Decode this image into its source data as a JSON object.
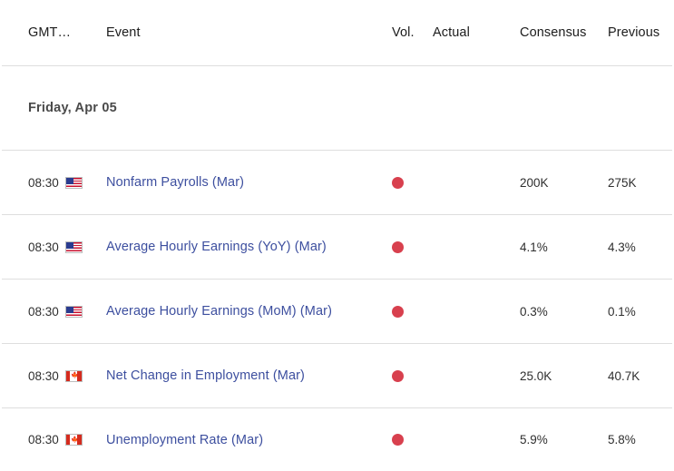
{
  "table": {
    "columns": [
      {
        "key": "gmt",
        "label": "GMT…"
      },
      {
        "key": "event",
        "label": "Event"
      },
      {
        "key": "vol",
        "label": "Vol."
      },
      {
        "key": "actual",
        "label": "Actual"
      },
      {
        "key": "consensus",
        "label": "Consensus"
      },
      {
        "key": "previous",
        "label": "Previous"
      }
    ],
    "date_group": {
      "label": "Friday, Apr 05"
    },
    "rows": [
      {
        "time": "08:30",
        "flag": "us-flag-icon",
        "flag_emoji": "🇺🇸",
        "event": "Nonfarm Payrolls (Mar)",
        "volatility": "high",
        "volatility_color": "#d8404e",
        "actual": "",
        "consensus": "200K",
        "previous": "275K"
      },
      {
        "time": "08:30",
        "flag": "us-flag-icon",
        "flag_emoji": "🇺🇸",
        "event": "Average Hourly Earnings (YoY) (Mar)",
        "volatility": "high",
        "volatility_color": "#d8404e",
        "actual": "",
        "consensus": "4.1%",
        "previous": "4.3%"
      },
      {
        "time": "08:30",
        "flag": "us-flag-icon",
        "flag_emoji": "🇺🇸",
        "event": "Average Hourly Earnings (MoM) (Mar)",
        "volatility": "high",
        "volatility_color": "#d8404e",
        "actual": "",
        "consensus": "0.3%",
        "previous": "0.1%"
      },
      {
        "time": "08:30",
        "flag": "ca-flag-icon",
        "flag_emoji": "🇨🇦",
        "event": "Net Change in Employment (Mar)",
        "volatility": "high",
        "volatility_color": "#d8404e",
        "actual": "",
        "consensus": "25.0K",
        "previous": "40.7K"
      },
      {
        "time": "08:30",
        "flag": "ca-flag-icon",
        "flag_emoji": "🇨🇦",
        "event": "Unemployment Rate (Mar)",
        "volatility": "high",
        "volatility_color": "#d8404e",
        "actual": "",
        "consensus": "5.9%",
        "previous": "5.8%"
      }
    ]
  }
}
